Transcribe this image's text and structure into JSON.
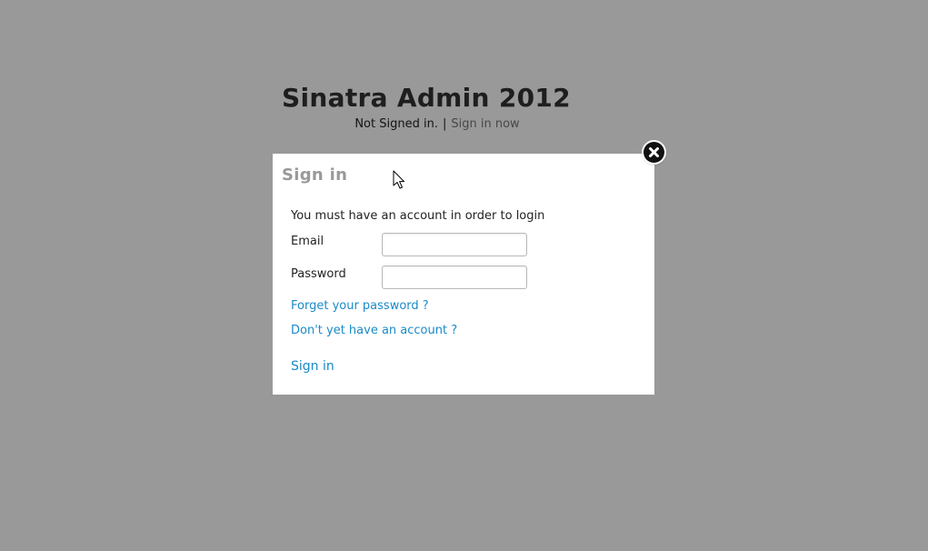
{
  "page": {
    "title": "Sinatra Admin 2012",
    "status_text": "Not Signed in.",
    "separator": "|",
    "sign_in_link": "Sign in now"
  },
  "modal": {
    "title": "Sign in",
    "intro": "You must have an account in order to login",
    "email_label": "Email",
    "email_value": "",
    "password_label": "Password",
    "password_value": "",
    "forgot_link": "Forget your password ?",
    "register_link": "Don't yet have an account ?",
    "submit_link": "Sign in",
    "close_icon": "close-icon"
  },
  "colors": {
    "overlay": "rgba(0,0,0,0.4)",
    "link": "#1a8ac8",
    "modal_title": "#999999"
  }
}
